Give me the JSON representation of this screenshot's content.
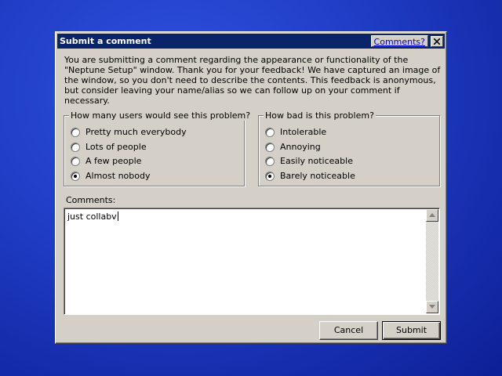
{
  "dialog": {
    "title": "Submit a comment",
    "help_link": "Comments?",
    "intro_text": "You are submitting a comment regarding the appearance or functionality of the \"Neptune Setup\" window. Thank you for your feedback! We have captured an image of the window, so you don't need to describe the contents. This feedback is anonymous, but consider leaving your name/alias so we can follow up on your comment if necessary."
  },
  "users_group": {
    "legend": "How many users would see this problem?",
    "options": [
      "Pretty much everybody",
      "Lots of people",
      "A few people",
      "Almost nobody"
    ],
    "selected_index": 3
  },
  "severity_group": {
    "legend": "How bad is this problem?",
    "options": [
      "Intolerable",
      "Annoying",
      "Easily noticeable",
      "Barely noticeable"
    ],
    "selected_index": 3
  },
  "comments": {
    "label": "Comments:",
    "value": "just collabv"
  },
  "buttons": {
    "cancel": "Cancel",
    "submit": "Submit"
  },
  "colors": {
    "desktop": "#1c38b8",
    "titlebar": "#0a246a",
    "face": "#d4d0c8",
    "link": "#0000cc"
  },
  "icons": {
    "close": "close-icon",
    "scroll_up": "arrow-up-icon",
    "scroll_down": "arrow-down-icon"
  }
}
